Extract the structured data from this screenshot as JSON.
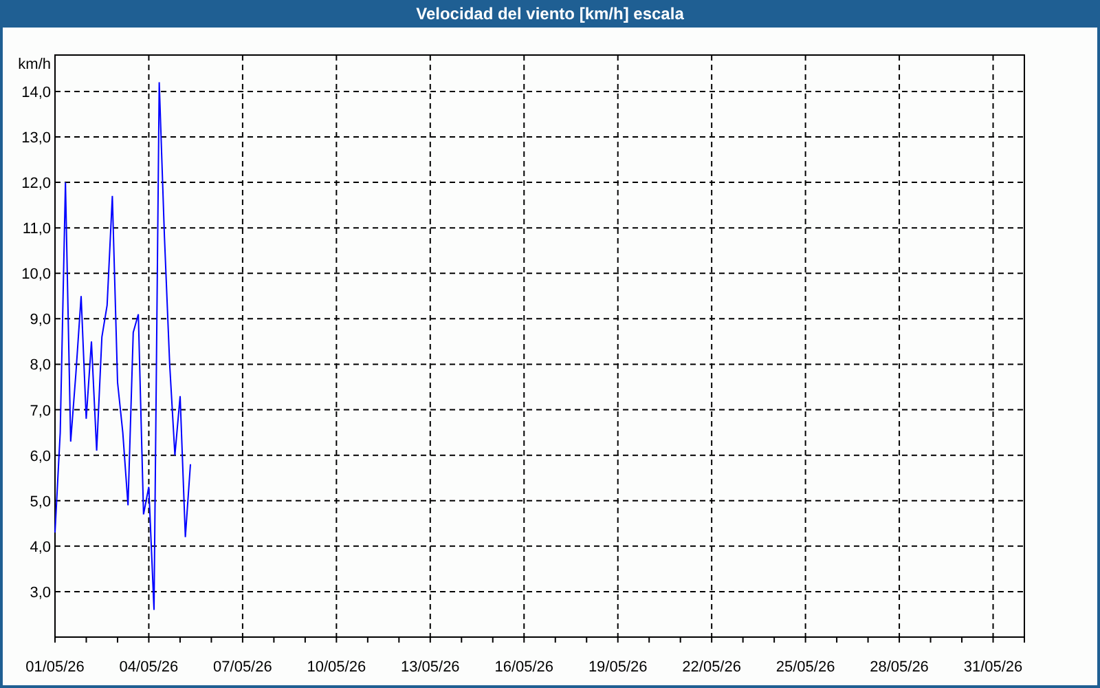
{
  "window": {
    "title": "Velocidad del viento [km/h] escala"
  },
  "chart": {
    "chart_data": {
      "type": "line",
      "grid": true,
      "ylabel": "km/h",
      "ylim": [
        2,
        14.8
      ],
      "categories": [
        "01/05/26",
        null,
        null,
        null,
        null,
        null,
        null,
        null,
        null,
        null,
        null,
        null,
        null,
        null,
        null,
        null,
        null,
        null,
        "04/05/26",
        null,
        null,
        null,
        null,
        null,
        null,
        null,
        null,
        null,
        null,
        null,
        null,
        null,
        null,
        null,
        null,
        null,
        "07/05/26",
        null,
        null,
        null,
        null,
        null,
        null,
        null,
        null,
        null,
        null,
        null,
        null,
        null,
        null,
        null,
        null,
        null,
        "10/05/26",
        null,
        null,
        null,
        null,
        null,
        null,
        null,
        null,
        null,
        null,
        null,
        null,
        null,
        null,
        null,
        null,
        null,
        "13/05/26",
        null,
        null,
        null,
        null,
        null,
        null,
        null,
        null,
        null,
        null,
        null,
        null,
        null,
        null,
        null,
        null,
        null,
        "16/05/26",
        null,
        null,
        null,
        null,
        null,
        null,
        null,
        null,
        null,
        null,
        null,
        null,
        null,
        null,
        null,
        null,
        null,
        "19/05/26",
        null,
        null,
        null,
        null,
        null,
        null,
        null,
        null,
        null,
        null,
        null,
        null,
        null,
        null,
        null,
        null,
        null,
        "22/05/26",
        null,
        null,
        null,
        null,
        null,
        null,
        null,
        null,
        null,
        null,
        null,
        null,
        null,
        null,
        null,
        null,
        null,
        "25/05/26",
        null,
        null,
        null,
        null,
        null,
        null,
        null,
        null,
        null,
        null,
        null,
        null,
        null,
        null,
        null,
        null,
        null,
        "28/05/26",
        null,
        null,
        null,
        null,
        null,
        null,
        null,
        null,
        null,
        null,
        null,
        null,
        null,
        null,
        null,
        null,
        null,
        "31/05/26",
        null,
        null,
        null,
        null,
        null,
        null
      ],
      "yticks": [
        {
          "value": 3,
          "label": "3,0"
        },
        {
          "value": 4,
          "label": "4,0"
        },
        {
          "value": 5,
          "label": "5,0"
        },
        {
          "value": 6,
          "label": "6,0"
        },
        {
          "value": 7,
          "label": "7,0"
        },
        {
          "value": 8,
          "label": "8,0"
        },
        {
          "value": 9,
          "label": "9,0"
        },
        {
          "value": 10,
          "label": "10,0"
        },
        {
          "value": 11,
          "label": "11,0"
        },
        {
          "value": 12,
          "label": "12,0"
        },
        {
          "value": 13,
          "label": "13,0"
        },
        {
          "value": 14,
          "label": "14,0"
        }
      ],
      "series": [
        {
          "color": "#0000ff",
          "values": [
            4.3,
            6.5,
            12.0,
            6.3,
            7.8,
            9.5,
            6.8,
            8.5,
            6.1,
            8.6,
            9.3,
            11.7,
            7.6,
            6.5,
            4.9,
            8.7,
            9.1,
            4.7,
            5.3,
            2.6,
            14.2,
            10.8,
            8.0,
            6.0,
            7.3,
            4.2,
            5.8,
            null,
            null,
            null,
            null,
            null,
            null,
            null,
            null,
            null,
            null,
            null,
            null,
            null,
            null,
            null,
            null,
            null,
            null,
            null,
            null,
            null,
            null,
            null,
            null,
            null,
            null,
            null,
            null,
            null,
            null,
            null,
            null,
            null,
            null,
            null,
            null,
            null,
            null,
            null,
            null,
            null,
            null,
            null,
            null,
            null,
            null,
            null,
            null,
            null,
            null,
            null,
            null,
            null,
            null,
            null,
            null,
            null,
            null,
            null,
            null,
            null,
            null,
            null,
            null,
            null,
            null,
            null,
            null,
            null,
            null,
            null,
            null,
            null,
            null,
            null,
            null,
            null,
            null,
            null,
            null,
            null,
            null,
            null,
            null,
            null,
            null,
            null,
            null,
            null,
            null,
            null,
            null,
            null,
            null,
            null,
            null,
            null,
            null,
            null,
            null,
            null,
            null,
            null,
            null,
            null,
            null,
            null,
            null,
            null,
            null,
            null,
            null,
            null,
            null,
            null,
            null,
            null,
            null,
            null,
            null,
            null,
            null,
            null,
            null,
            null,
            null,
            null,
            null,
            null,
            null,
            null,
            null,
            null,
            null,
            null,
            null,
            null,
            null,
            null,
            null,
            null,
            null,
            null,
            null,
            null,
            null,
            null,
            null,
            null,
            null,
            null,
            null,
            null,
            null,
            null,
            null,
            null,
            null,
            null,
            null
          ]
        }
      ]
    }
  }
}
